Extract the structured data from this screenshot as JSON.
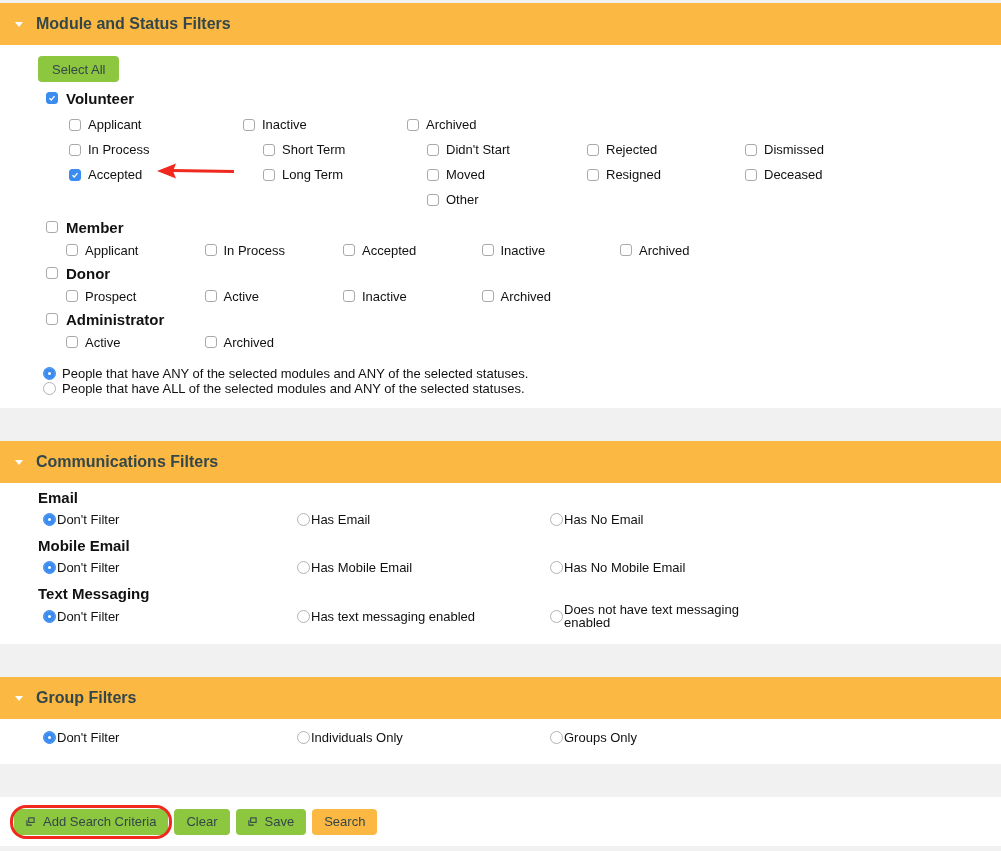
{
  "sections": [
    {
      "kind": "modules",
      "title": "Module and Status Filters",
      "expanded": true,
      "select_all": "Select All",
      "modules": [
        {
          "name": "Volunteer",
          "checked": true,
          "kind": "grouped",
          "statuses": [
            {
              "label": "Applicant",
              "checked": false
            },
            {
              "label": "In Process",
              "checked": false
            },
            {
              "label": "Accepted",
              "checked": true,
              "pointed": true
            },
            {
              "label": "Inactive",
              "checked": false,
              "children": [
                {
                  "label": "Short Term",
                  "checked": false
                },
                {
                  "label": "Long Term",
                  "checked": false
                }
              ]
            },
            {
              "label": "Archived",
              "checked": false,
              "children": [
                {
                  "label": "Didn't Start",
                  "checked": false
                },
                {
                  "label": "Rejected",
                  "checked": false
                },
                {
                  "label": "Dismissed",
                  "checked": false
                },
                {
                  "label": "Moved",
                  "checked": false
                },
                {
                  "label": "Resigned",
                  "checked": false
                },
                {
                  "label": "Deceased",
                  "checked": false
                },
                {
                  "label": "Other",
                  "checked": false
                }
              ]
            }
          ]
        },
        {
          "name": "Member",
          "checked": false,
          "kind": "inline",
          "statuses": [
            {
              "label": "Applicant",
              "checked": false
            },
            {
              "label": "In Process",
              "checked": false
            },
            {
              "label": "Accepted",
              "checked": false
            },
            {
              "label": "Inactive",
              "checked": false
            },
            {
              "label": "Archived",
              "checked": false
            }
          ]
        },
        {
          "name": "Donor",
          "checked": false,
          "kind": "inline",
          "statuses": [
            {
              "label": "Prospect",
              "checked": false
            },
            {
              "label": "Active",
              "checked": false
            },
            {
              "label": "Inactive",
              "checked": false
            },
            {
              "label": "Archived",
              "checked": false
            }
          ]
        },
        {
          "name": "Administrator",
          "checked": false,
          "kind": "inline",
          "statuses": [
            {
              "label": "Active",
              "checked": false
            },
            {
              "label": "Archived",
              "checked": false
            }
          ]
        }
      ],
      "match_options": [
        {
          "label": "People that have ANY of the selected modules and ANY of the selected statuses.",
          "selected": true
        },
        {
          "label": "People that have ALL of the selected modules and ANY of the selected statuses.",
          "selected": false
        }
      ]
    },
    {
      "kind": "radio_groups",
      "title": "Communications Filters",
      "expanded": true,
      "groups": [
        {
          "label": "Email",
          "options": [
            {
              "label": "Don't Filter",
              "selected": true
            },
            {
              "label": "Has Email",
              "selected": false
            },
            {
              "label": "Has No Email",
              "selected": false
            }
          ]
        },
        {
          "label": "Mobile Email",
          "options": [
            {
              "label": "Don't Filter",
              "selected": true
            },
            {
              "label": "Has Mobile Email",
              "selected": false
            },
            {
              "label": "Has No Mobile Email",
              "selected": false
            }
          ]
        },
        {
          "label": "Text Messaging",
          "options": [
            {
              "label": "Don't Filter",
              "selected": true
            },
            {
              "label": "Has text messaging enabled",
              "selected": false
            },
            {
              "label": "Does not have text messaging enabled",
              "selected": false
            }
          ]
        }
      ]
    },
    {
      "kind": "radio_groups",
      "title": "Group Filters",
      "expanded": true,
      "groups": [
        {
          "options": [
            {
              "label": "Don't Filter",
              "selected": true
            },
            {
              "label": "Individuals Only",
              "selected": false
            },
            {
              "label": "Groups Only",
              "selected": false
            }
          ]
        }
      ]
    }
  ],
  "buttons": [
    {
      "label": "Add Search Criteria",
      "kind": "action",
      "icon": true,
      "circled": true
    },
    {
      "label": "Clear",
      "kind": "action"
    },
    {
      "label": "Save",
      "kind": "action",
      "icon": true
    },
    {
      "label": "Search",
      "kind": "submit"
    }
  ]
}
